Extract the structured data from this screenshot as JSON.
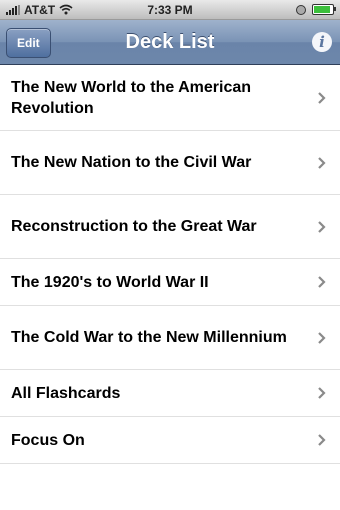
{
  "status_bar": {
    "carrier": "AT&T",
    "time": "7:33 PM"
  },
  "nav": {
    "title": "Deck List",
    "edit_label": "Edit",
    "info_symbol": "i"
  },
  "decks": [
    {
      "label": "The New World to the American Revolution"
    },
    {
      "label": "The New Nation to the Civil War"
    },
    {
      "label": "Reconstruction to the Great War"
    },
    {
      "label": "The 1920's to World War II"
    },
    {
      "label": "The Cold War to the New Millennium"
    },
    {
      "label": "All Flashcards"
    },
    {
      "label": "Focus On"
    }
  ],
  "colors": {
    "nav_bar": "#7a93b5",
    "battery": "#3bbf3b"
  }
}
